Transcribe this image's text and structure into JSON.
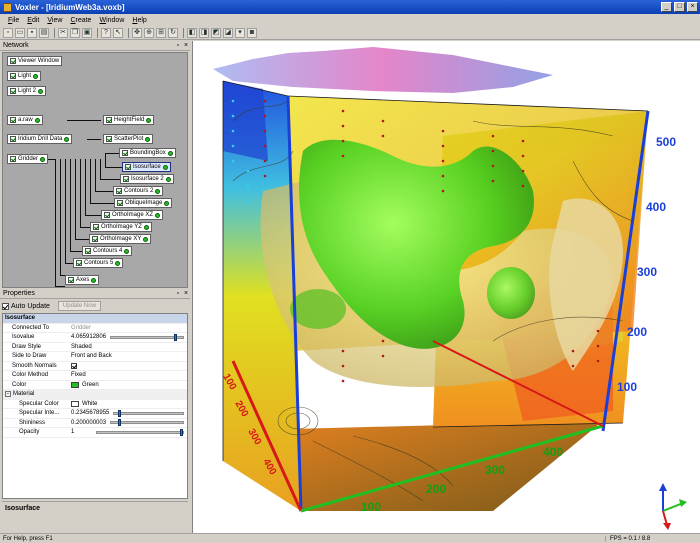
{
  "window": {
    "title": "Voxler - [IridiumWeb3a.voxb]",
    "min": "_",
    "max": "□",
    "close": "×"
  },
  "menu": [
    {
      "label": "File",
      "u": "F",
      "rest": "ile"
    },
    {
      "label": "Edit",
      "u": "E",
      "rest": "dit"
    },
    {
      "label": "View",
      "u": "V",
      "rest": "iew"
    },
    {
      "label": "Create",
      "u": "C",
      "rest": "reate"
    },
    {
      "label": "Window",
      "u": "W",
      "rest": "indow"
    },
    {
      "label": "Help",
      "u": "H",
      "rest": "elp"
    }
  ],
  "network": {
    "title": "Network",
    "nodes": [
      {
        "label": "Viewer Window"
      },
      {
        "label": "Light"
      },
      {
        "label": "Light 2"
      },
      {
        "label": "a.raw"
      },
      {
        "label": "HeightField"
      },
      {
        "label": "Iridium Drill Data"
      },
      {
        "label": "ScatterPlot"
      },
      {
        "label": "Gridder"
      },
      {
        "label": "BoundingBox"
      },
      {
        "label": "Isosurface"
      },
      {
        "label": "Isosurface 2"
      },
      {
        "label": "Contours 2"
      },
      {
        "label": "ObliqueImage"
      },
      {
        "label": "OrthoImage XZ"
      },
      {
        "label": "OrthoImage YZ"
      },
      {
        "label": "OrthoImage XY"
      },
      {
        "label": "Contours 4"
      },
      {
        "label": "Contours 5"
      },
      {
        "label": "Axes"
      }
    ]
  },
  "properties": {
    "title": "Properties",
    "auto_update": "Auto Update",
    "update_now": "Update Now",
    "group": "Isosurface",
    "rows": {
      "connected_to": {
        "label": "Connected To",
        "value": "Gridder"
      },
      "isovalue": {
        "label": "Isovalue",
        "value": "4.065912806",
        "level": 0.9
      },
      "draw_style": {
        "label": "Draw Style",
        "value": "Shaded"
      },
      "side_to_draw": {
        "label": "Side to Draw",
        "value": "Front and Back"
      },
      "smooth_normals": {
        "label": "Smooth Normals"
      },
      "color_method": {
        "label": "Color Method",
        "value": "Fixed"
      },
      "color": {
        "label": "Color",
        "value": "Green"
      },
      "material": {
        "label": "Material"
      },
      "specular_color": {
        "label": "Specular Color",
        "value": "White"
      },
      "specular_inte": {
        "label": "Specular Inte...",
        "value": "0.2345678955",
        "level": 0.23
      },
      "shininess": {
        "label": "Shininess",
        "value": "0.200000003",
        "level": 0.2
      },
      "opacity": {
        "label": "Opacity",
        "value": "1",
        "level": 1.0
      }
    },
    "help_title": "Isosurface"
  },
  "viewer": {
    "right_ticks": [
      "500",
      "400",
      "300",
      "200",
      "100"
    ],
    "left_ticks": [
      "100",
      "200",
      "300",
      "400"
    ],
    "bottom_ticks": [
      "100",
      "200",
      "300",
      "400"
    ]
  },
  "colors": {
    "green_swatch": "#20c020",
    "white_swatch": "#ffffff",
    "axis_blue": "#1a3fd8",
    "axis_red": "#d81818",
    "axis_green": "#20c020"
  },
  "status": {
    "help": "For Help, press F1",
    "fps": "FPS = 0.1 / 8.8"
  }
}
